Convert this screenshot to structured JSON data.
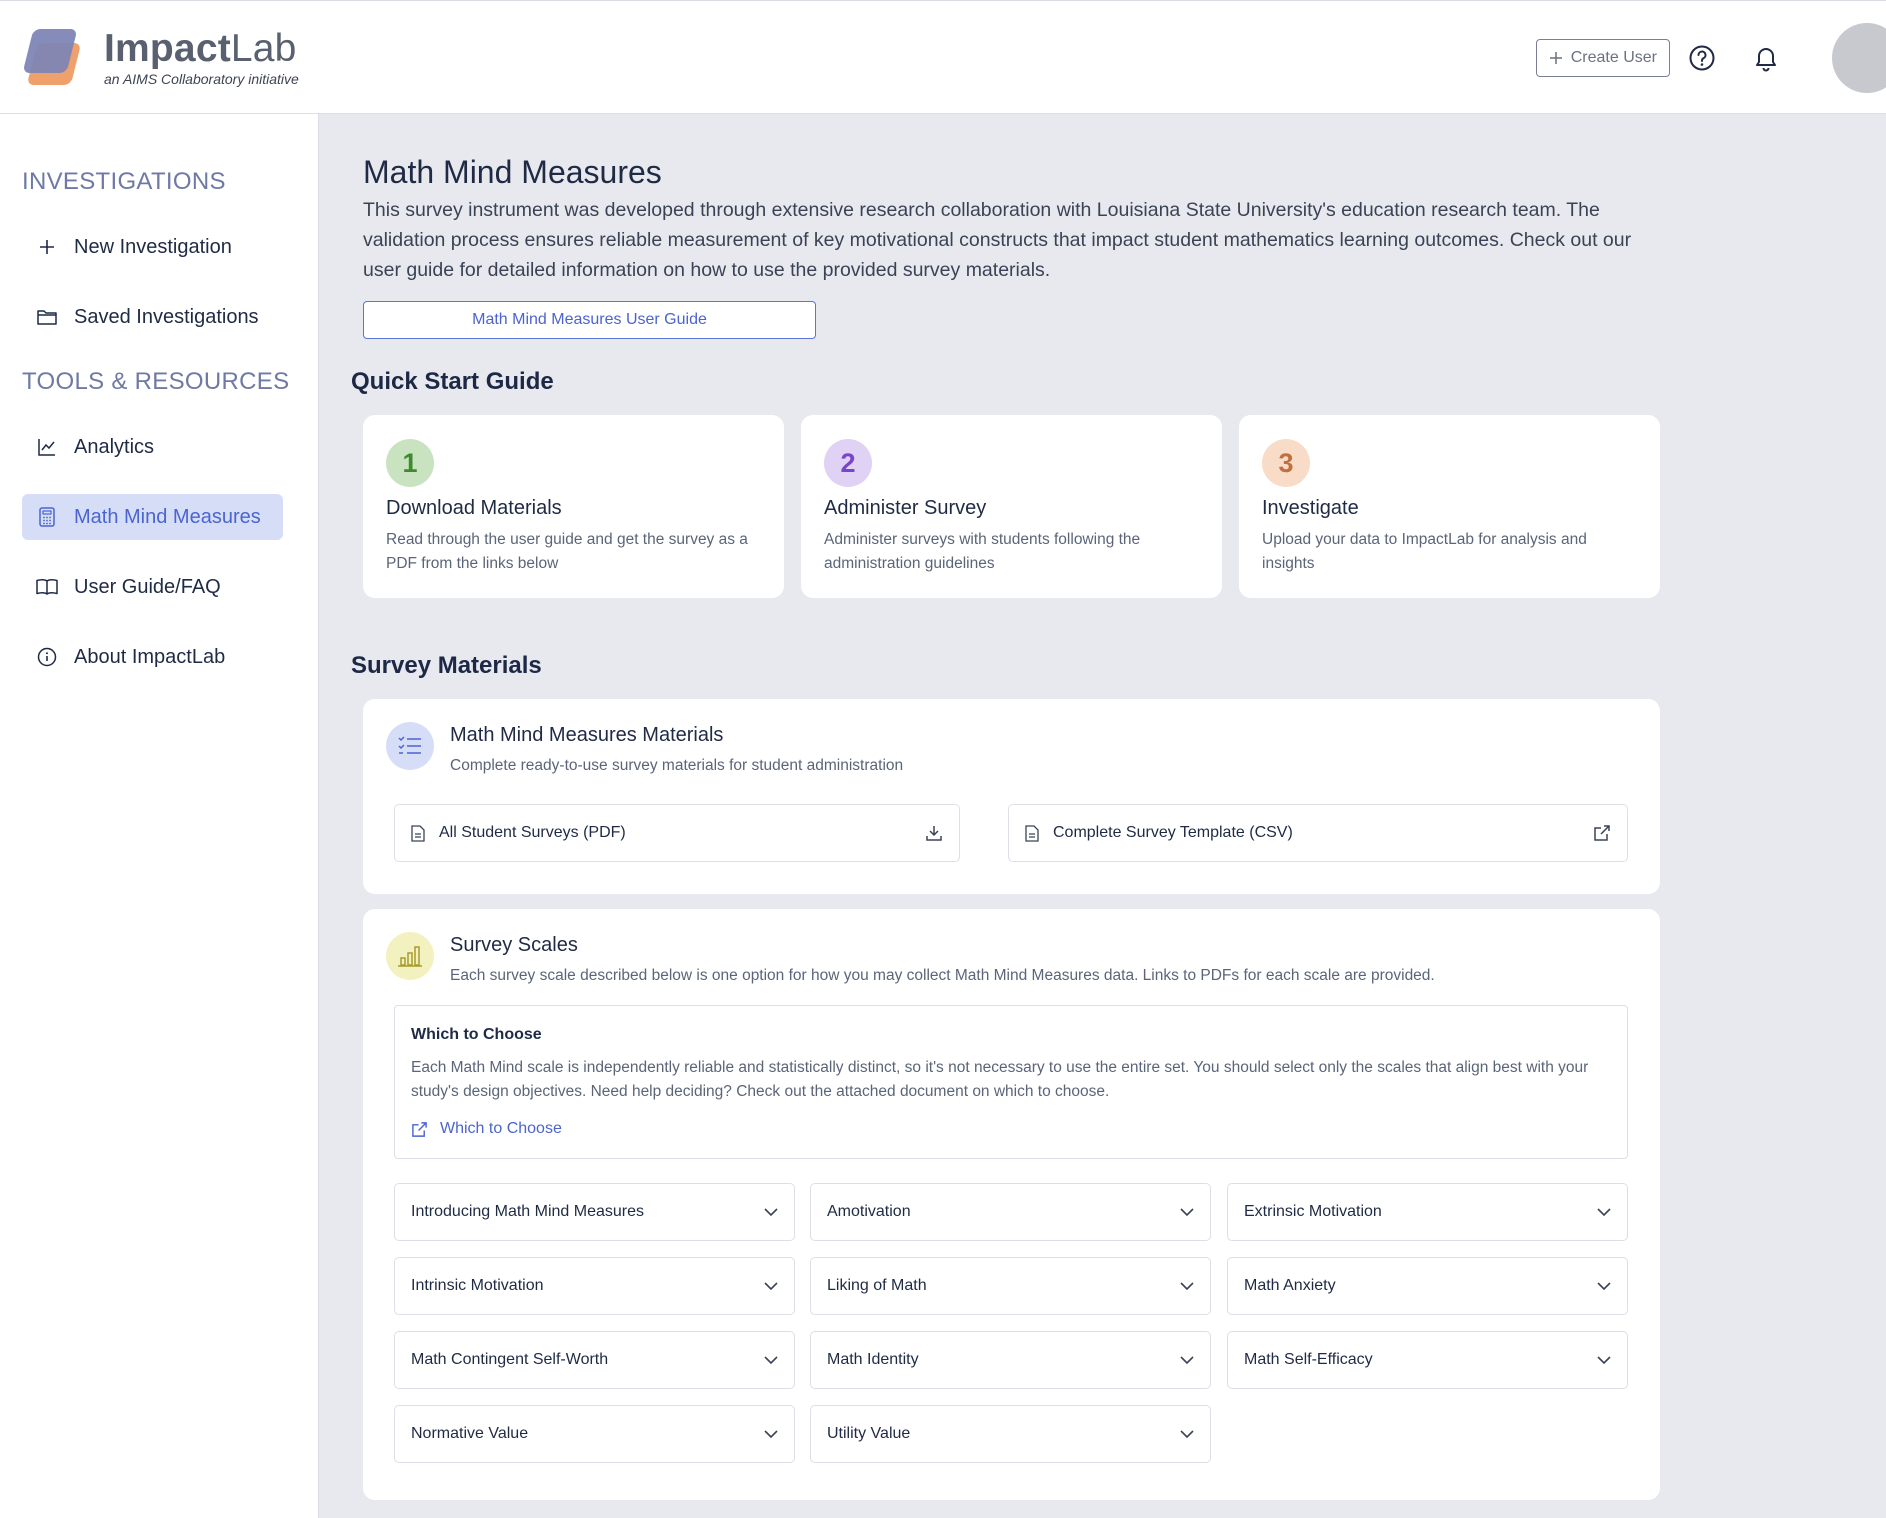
{
  "header": {
    "brand_main": "Impact",
    "brand_lab": "Lab",
    "brand_sub": "an AIMS Collaboratory initiative",
    "create_user_label": "Create User",
    "icons": [
      "help-icon",
      "bell-icon"
    ]
  },
  "sidebar": {
    "section1": "INVESTIGATIONS",
    "section2": "TOOLS & RESOURCES",
    "items": [
      {
        "label": "New Investigation",
        "icon": "plus-icon"
      },
      {
        "label": "Saved Investigations",
        "icon": "folder-icon"
      },
      {
        "label": "Analytics",
        "icon": "chart-line-icon"
      },
      {
        "label": "Math Mind Measures",
        "icon": "calculator-icon",
        "active": true
      },
      {
        "label": "User Guide/FAQ",
        "icon": "book-icon"
      },
      {
        "label": "About ImpactLab",
        "icon": "info-icon"
      }
    ],
    "active_color": "#4b64d0"
  },
  "main": {
    "title": "Math Mind Measures",
    "description": "This survey instrument was developed through extensive research collaboration with Louisiana State University's education research team. The validation process ensures reliable measurement of key motivational constructs that impact student mathematics learning outcomes. Check out our user guide for detailed information on how to use the provided survey materials.",
    "user_guide_button": "Math Mind Measures User Guide",
    "quick_start_title": "Quick Start Guide",
    "steps": [
      {
        "num": "1",
        "title": "Download Materials",
        "desc": "Read through the user guide and get the survey as a PDF from the links below",
        "color": "#3f8a2f",
        "bg": "#c9e3c0"
      },
      {
        "num": "2",
        "title": "Administer Survey",
        "desc": "Administer surveys with students following the administration guidelines",
        "color": "#7a45c9",
        "bg": "#e0d2f4"
      },
      {
        "num": "3",
        "title": "Investigate",
        "desc": "Upload your data to ImpactLab for analysis and insights",
        "color": "#c07040",
        "bg": "#f8dcc8"
      }
    ],
    "survey_materials_title": "Survey Materials",
    "materials_card": {
      "title": "Math Mind Measures Materials",
      "subtitle": "Complete ready-to-use survey materials for student administration",
      "files": [
        {
          "label": "All Student Surveys (PDF)",
          "action_icon": "download-icon"
        },
        {
          "label": "Complete Survey Template (CSV)",
          "action_icon": "external-link-icon"
        }
      ]
    },
    "scales_card": {
      "title": "Survey Scales",
      "subtitle": "Each survey scale described below is one option for how you may collect Math Mind Measures data. Links to PDFs for each scale are provided.",
      "choose_title": "Which to Choose",
      "choose_desc": "Each Math Mind scale is independently reliable and statistically distinct, so it's not necessary to use the entire set. You should select only the scales that align best with your study's design objectives. Need help deciding? Check out the attached document on which to choose.",
      "choose_link": "Which to Choose",
      "scales": [
        "Introducing Math Mind Measures",
        "Amotivation",
        "Extrinsic Motivation",
        "Intrinsic Motivation",
        "Liking of Math",
        "Math Anxiety",
        "Math Contingent Self-Worth",
        "Math Identity",
        "Math Self-Efficacy",
        "Normative Value",
        "Utility Value"
      ]
    }
  }
}
